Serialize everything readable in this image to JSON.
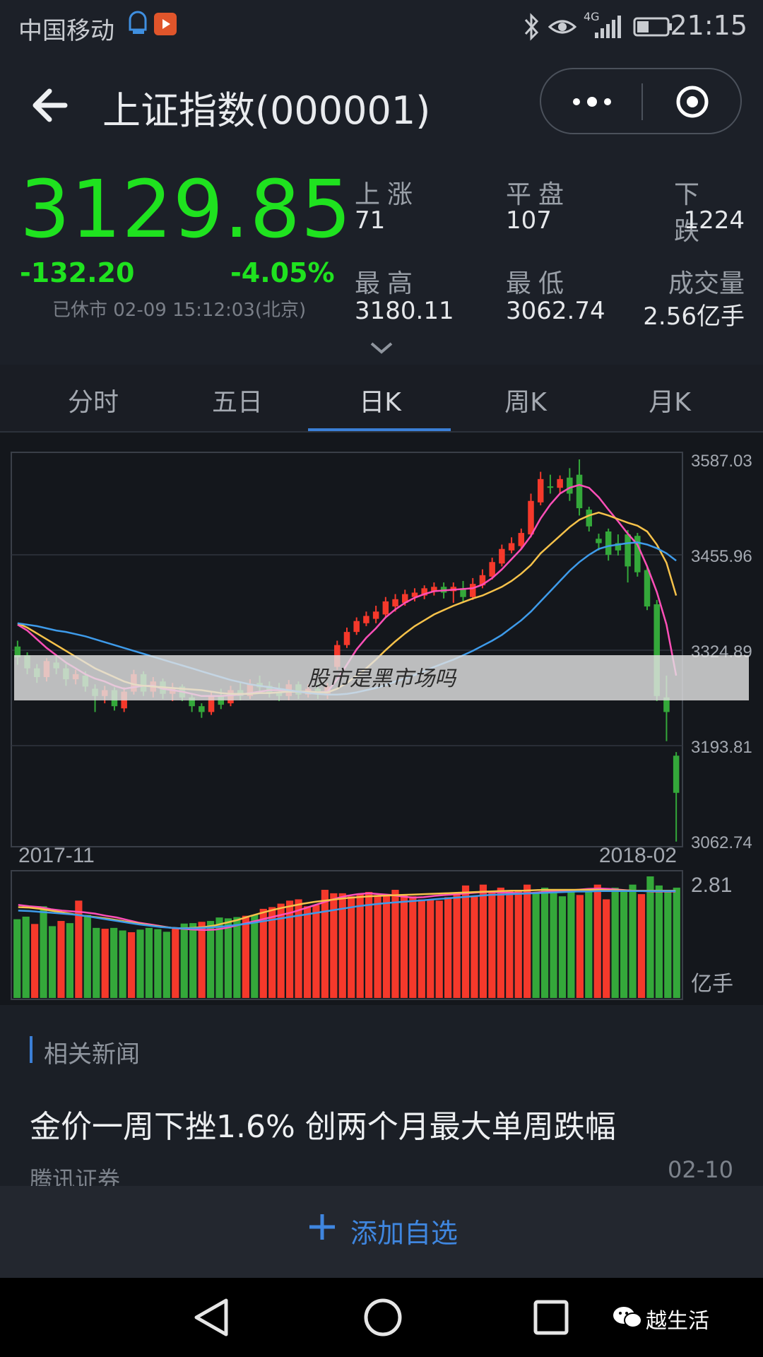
{
  "status_bar": {
    "carrier": "中国移动",
    "network": "4G",
    "time": "21:15"
  },
  "header": {
    "title": "上证指数(000001)"
  },
  "quote": {
    "price": "3129.85",
    "change": "-132.20",
    "change_percent": "-4.05%",
    "market_status": "已休市 02-09 15:12:03(北京)",
    "stats": [
      {
        "label": "上涨",
        "value": "71"
      },
      {
        "label": "平盘",
        "value": "107"
      },
      {
        "label": "下跌",
        "value": "1224"
      },
      {
        "label": "最高",
        "value": "3180.11"
      },
      {
        "label": "最低",
        "value": "3062.74"
      },
      {
        "label": "成交量",
        "value": "2.56亿手"
      }
    ]
  },
  "tabs": [
    {
      "label": "分时",
      "active": false
    },
    {
      "label": "五日",
      "active": false
    },
    {
      "label": "日K",
      "active": true
    },
    {
      "label": "周K",
      "active": false
    },
    {
      "label": "月K",
      "active": false
    }
  ],
  "chart_data": [
    {
      "type": "candlestick",
      "y_ticks": [
        "3587.03",
        "3455.96",
        "3324.89",
        "3193.81",
        "3062.74"
      ],
      "ylim": [
        3062.74,
        3587.03
      ],
      "x_start_label": "2017-11",
      "x_end_label": "2018-02",
      "candles": [
        {
          "o": 3330,
          "c": 3315,
          "h": 3338,
          "l": 3305
        },
        {
          "o": 3318,
          "c": 3300,
          "h": 3322,
          "l": 3292
        },
        {
          "o": 3300,
          "c": 3288,
          "h": 3306,
          "l": 3280
        },
        {
          "o": 3288,
          "c": 3310,
          "h": 3314,
          "l": 3282
        },
        {
          "o": 3308,
          "c": 3300,
          "h": 3318,
          "l": 3292
        },
        {
          "o": 3300,
          "c": 3285,
          "h": 3306,
          "l": 3276
        },
        {
          "o": 3285,
          "c": 3292,
          "h": 3298,
          "l": 3278
        },
        {
          "o": 3290,
          "c": 3275,
          "h": 3296,
          "l": 3268
        },
        {
          "o": 3272,
          "c": 3262,
          "h": 3278,
          "l": 3240
        },
        {
          "o": 3262,
          "c": 3270,
          "h": 3276,
          "l": 3252
        },
        {
          "o": 3270,
          "c": 3248,
          "h": 3274,
          "l": 3242
        },
        {
          "o": 3245,
          "c": 3268,
          "h": 3274,
          "l": 3240
        },
        {
          "o": 3268,
          "c": 3292,
          "h": 3298,
          "l": 3264
        },
        {
          "o": 3292,
          "c": 3268,
          "h": 3296,
          "l": 3262
        },
        {
          "o": 3268,
          "c": 3282,
          "h": 3288,
          "l": 3260
        },
        {
          "o": 3282,
          "c": 3265,
          "h": 3286,
          "l": 3258
        },
        {
          "o": 3265,
          "c": 3273,
          "h": 3280,
          "l": 3255
        },
        {
          "o": 3275,
          "c": 3260,
          "h": 3278,
          "l": 3255
        },
        {
          "o": 3260,
          "c": 3248,
          "h": 3264,
          "l": 3240
        },
        {
          "o": 3248,
          "c": 3240,
          "h": 3252,
          "l": 3232
        },
        {
          "o": 3240,
          "c": 3262,
          "h": 3268,
          "l": 3236
        },
        {
          "o": 3262,
          "c": 3250,
          "h": 3272,
          "l": 3244
        },
        {
          "o": 3252,
          "c": 3270,
          "h": 3276,
          "l": 3248
        },
        {
          "o": 3270,
          "c": 3262,
          "h": 3280,
          "l": 3256
        },
        {
          "o": 3262,
          "c": 3278,
          "h": 3285,
          "l": 3258
        },
        {
          "o": 3280,
          "c": 3274,
          "h": 3290,
          "l": 3268
        },
        {
          "o": 3276,
          "c": 3266,
          "h": 3282,
          "l": 3260
        },
        {
          "o": 3268,
          "c": 3262,
          "h": 3280,
          "l": 3255
        },
        {
          "o": 3262,
          "c": 3278,
          "h": 3284,
          "l": 3256
        },
        {
          "o": 3278,
          "c": 3264,
          "h": 3282,
          "l": 3258
        },
        {
          "o": 3264,
          "c": 3272,
          "h": 3278,
          "l": 3260
        },
        {
          "o": 3272,
          "c": 3264,
          "h": 3280,
          "l": 3258
        },
        {
          "o": 3264,
          "c": 3275,
          "h": 3280,
          "l": 3258
        },
        {
          "o": 3302,
          "c": 3332,
          "h": 3338,
          "l": 3298
        },
        {
          "o": 3332,
          "c": 3350,
          "h": 3356,
          "l": 3328
        },
        {
          "o": 3350,
          "c": 3365,
          "h": 3370,
          "l": 3346
        },
        {
          "o": 3362,
          "c": 3372,
          "h": 3378,
          "l": 3358
        },
        {
          "o": 3368,
          "c": 3378,
          "h": 3386,
          "l": 3362
        },
        {
          "o": 3374,
          "c": 3392,
          "h": 3398,
          "l": 3370
        },
        {
          "o": 3385,
          "c": 3395,
          "h": 3402,
          "l": 3378
        },
        {
          "o": 3390,
          "c": 3402,
          "h": 3408,
          "l": 3386
        },
        {
          "o": 3398,
          "c": 3404,
          "h": 3410,
          "l": 3392
        },
        {
          "o": 3400,
          "c": 3410,
          "h": 3414,
          "l": 3395
        },
        {
          "o": 3406,
          "c": 3412,
          "h": 3418,
          "l": 3400
        },
        {
          "o": 3412,
          "c": 3404,
          "h": 3418,
          "l": 3396
        },
        {
          "o": 3406,
          "c": 3412,
          "h": 3418,
          "l": 3390
        },
        {
          "o": 3410,
          "c": 3398,
          "h": 3420,
          "l": 3392
        },
        {
          "o": 3398,
          "c": 3416,
          "h": 3424,
          "l": 3394
        },
        {
          "o": 3414,
          "c": 3428,
          "h": 3436,
          "l": 3410
        },
        {
          "o": 3426,
          "c": 3446,
          "h": 3452,
          "l": 3422
        },
        {
          "o": 3444,
          "c": 3464,
          "h": 3470,
          "l": 3440
        },
        {
          "o": 3462,
          "c": 3472,
          "h": 3480,
          "l": 3458
        },
        {
          "o": 3468,
          "c": 3486,
          "h": 3492,
          "l": 3464
        },
        {
          "o": 3484,
          "c": 3530,
          "h": 3540,
          "l": 3480
        },
        {
          "o": 3528,
          "c": 3560,
          "h": 3570,
          "l": 3524
        },
        {
          "o": 3550,
          "c": 3548,
          "h": 3566,
          "l": 3540
        },
        {
          "o": 3548,
          "c": 3560,
          "h": 3565,
          "l": 3540
        },
        {
          "o": 3562,
          "c": 3540,
          "h": 3575,
          "l": 3530
        },
        {
          "o": 3566,
          "c": 3520,
          "h": 3587,
          "l": 3510
        },
        {
          "o": 3518,
          "c": 3495,
          "h": 3522,
          "l": 3488
        },
        {
          "o": 3478,
          "c": 3472,
          "h": 3485,
          "l": 3462
        },
        {
          "o": 3488,
          "c": 3456,
          "h": 3492,
          "l": 3448
        },
        {
          "o": 3472,
          "c": 3462,
          "h": 3484,
          "l": 3455
        },
        {
          "o": 3484,
          "c": 3440,
          "h": 3490,
          "l": 3418
        },
        {
          "o": 3482,
          "c": 3432,
          "h": 3486,
          "l": 3426
        },
        {
          "o": 3435,
          "c": 3385,
          "h": 3440,
          "l": 3380
        },
        {
          "o": 3388,
          "c": 3262,
          "h": 3394,
          "l": 3255
        },
        {
          "o": 3260,
          "c": 3240,
          "h": 3290,
          "l": 3200
        },
        {
          "o": 3180,
          "c": 3129,
          "h": 3185,
          "l": 3062
        }
      ],
      "ma_lines": [
        {
          "color": "#ff4fb8",
          "values": [
            3360,
            3352,
            3340,
            3328,
            3318,
            3308,
            3300,
            3292,
            3286,
            3282,
            3276,
            3272,
            3274,
            3276,
            3276,
            3272,
            3270,
            3268,
            3265,
            3262,
            3262,
            3262,
            3263,
            3264,
            3266,
            3268,
            3270,
            3270,
            3268,
            3268,
            3268,
            3267,
            3268,
            3285,
            3305,
            3326,
            3342,
            3355,
            3370,
            3381,
            3390,
            3397,
            3402,
            3406,
            3407,
            3408,
            3409,
            3410,
            3415,
            3424,
            3436,
            3450,
            3464,
            3482,
            3506,
            3525,
            3540,
            3548,
            3552,
            3548,
            3535,
            3518,
            3502,
            3485,
            3470,
            3440,
            3405,
            3360,
            3290
          ]
        },
        {
          "color": "#f6c24a",
          "values": [
            3362,
            3356,
            3348,
            3340,
            3332,
            3324,
            3316,
            3308,
            3300,
            3294,
            3288,
            3282,
            3278,
            3276,
            3275,
            3274,
            3273,
            3272,
            3271,
            3270,
            3268,
            3266,
            3265,
            3265,
            3265,
            3266,
            3266,
            3267,
            3268,
            3268,
            3268,
            3267,
            3267,
            3272,
            3280,
            3290,
            3300,
            3312,
            3325,
            3337,
            3348,
            3358,
            3366,
            3374,
            3380,
            3386,
            3391,
            3396,
            3400,
            3406,
            3412,
            3420,
            3430,
            3442,
            3458,
            3470,
            3482,
            3494,
            3504,
            3510,
            3514,
            3510,
            3505,
            3500,
            3496,
            3488,
            3470,
            3445,
            3400
          ]
        },
        {
          "color": "#3e9bea",
          "values": [
            3362,
            3360,
            3358,
            3355,
            3352,
            3350,
            3347,
            3344,
            3340,
            3336,
            3332,
            3328,
            3324,
            3320,
            3316,
            3312,
            3308,
            3304,
            3300,
            3296,
            3292,
            3288,
            3284,
            3281,
            3278,
            3276,
            3274,
            3272,
            3270,
            3268,
            3266,
            3265,
            3264,
            3264,
            3265,
            3267,
            3270,
            3273,
            3277,
            3282,
            3286,
            3291,
            3296,
            3302,
            3307,
            3312,
            3318,
            3324,
            3331,
            3338,
            3346,
            3356,
            3366,
            3378,
            3392,
            3406,
            3420,
            3434,
            3446,
            3456,
            3464,
            3468,
            3470,
            3472,
            3473,
            3470,
            3465,
            3458,
            3448
          ]
        }
      ]
    },
    {
      "type": "bar",
      "unit_label": "亿手",
      "max_label": "2.81",
      "ylim": [
        0,
        2.81
      ],
      "values": [
        1.82,
        1.88,
        1.71,
        2.12,
        1.66,
        1.78,
        1.73,
        2.25,
        1.92,
        1.62,
        1.6,
        1.62,
        1.56,
        1.52,
        1.58,
        1.62,
        1.59,
        1.53,
        1.6,
        1.72,
        1.73,
        1.76,
        1.78,
        1.86,
        1.84,
        1.87,
        1.9,
        1.92,
        2.06,
        2.1,
        2.18,
        2.25,
        2.28,
        2.12,
        2.15,
        2.5,
        2.42,
        2.42,
        2.35,
        2.4,
        2.45,
        2.38,
        2.4,
        2.5,
        2.38,
        2.35,
        2.28,
        2.28,
        2.25,
        2.33,
        2.4,
        2.6,
        2.35,
        2.62,
        2.45,
        2.55,
        2.48,
        2.5,
        2.62,
        2.42,
        2.55,
        2.48,
        2.35,
        2.45,
        2.38,
        2.45,
        2.62,
        2.28,
        2.55,
        2.48,
        2.62,
        2.4,
        2.81,
        2.6,
        2.45,
        2.55
      ],
      "up": [
        false,
        false,
        true,
        false,
        false,
        true,
        false,
        true,
        false,
        false,
        true,
        false,
        false,
        true,
        false,
        false,
        false,
        false,
        true,
        false,
        false,
        true,
        false,
        false,
        false,
        false,
        true,
        false,
        true,
        true,
        true,
        true,
        true,
        true,
        true,
        true,
        true,
        true,
        true,
        true,
        true,
        true,
        true,
        true,
        true,
        true,
        true,
        true,
        true,
        true,
        true,
        true,
        true,
        true,
        true,
        true,
        true,
        true,
        true,
        false,
        false,
        false,
        false,
        false,
        true,
        false,
        true,
        true,
        false,
        false,
        false,
        true,
        false,
        false,
        false,
        false
      ],
      "ma_lines": [
        {
          "color": "#ff4fb8",
          "values": [
            2.15,
            2.12,
            2.1,
            2.05,
            2.02,
            2.0,
            1.98,
            1.95,
            1.9,
            1.86,
            1.8,
            1.74,
            1.7,
            1.66,
            1.62,
            1.6,
            1.58,
            1.57,
            1.58,
            1.62,
            1.68,
            1.74,
            1.8,
            1.86,
            1.92,
            1.98,
            2.06,
            2.14,
            2.22,
            2.3,
            2.36,
            2.4,
            2.42,
            2.4,
            2.38,
            2.35,
            2.32,
            2.33,
            2.36,
            2.38,
            2.4,
            2.42,
            2.44,
            2.45,
            2.44,
            2.43,
            2.42,
            2.43,
            2.45,
            2.47,
            2.48,
            2.5,
            2.52,
            2.53,
            2.52,
            2.5,
            2.48,
            2.47,
            2.46,
            2.46,
            2.46
          ]
        },
        {
          "color": "#f6c24a",
          "values": [
            2.1,
            2.09,
            2.06,
            2.02,
            1.98,
            1.94,
            1.9,
            1.87,
            1.84,
            1.8,
            1.76,
            1.72,
            1.68,
            1.65,
            1.62,
            1.61,
            1.62,
            1.64,
            1.68,
            1.74,
            1.8,
            1.88,
            1.95,
            2.02,
            2.08,
            2.13,
            2.18,
            2.22,
            2.25,
            2.28,
            2.31,
            2.33,
            2.35,
            2.36,
            2.37,
            2.38,
            2.39,
            2.4,
            2.41,
            2.42,
            2.43,
            2.44,
            2.45,
            2.46,
            2.47,
            2.48,
            2.48,
            2.49,
            2.5,
            2.5,
            2.5,
            2.5,
            2.5,
            2.5,
            2.49,
            2.49,
            2.48,
            2.48,
            2.48,
            2.48,
            2.48
          ]
        },
        {
          "color": "#3e9bea",
          "values": [
            2.02,
            2.01,
            1.99,
            1.97,
            1.95,
            1.93,
            1.9,
            1.86,
            1.82,
            1.78,
            1.74,
            1.7,
            1.67,
            1.64,
            1.62,
            1.61,
            1.61,
            1.62,
            1.64,
            1.66,
            1.69,
            1.72,
            1.76,
            1.8,
            1.84,
            1.88,
            1.92,
            1.96,
            2.0,
            2.04,
            2.08,
            2.12,
            2.15,
            2.18,
            2.2,
            2.22,
            2.24,
            2.26,
            2.28,
            2.3,
            2.32,
            2.34,
            2.36,
            2.38,
            2.39,
            2.4,
            2.41,
            2.42,
            2.43,
            2.44,
            2.45,
            2.46,
            2.46,
            2.47,
            2.47,
            2.47,
            2.47,
            2.47,
            2.47,
            2.47,
            2.47
          ]
        }
      ]
    }
  ],
  "overlay_caption": "股市是黑市场吗",
  "news": {
    "heading": "相关新闻",
    "title": "金价一周下挫1.6% 创两个月最大单周跌幅",
    "source": "腾讯证券",
    "date": "02-10"
  },
  "add_watchlist": "添加自选",
  "watermark": "越生活",
  "colors": {
    "up": "#f5392b",
    "down": "#34a83a",
    "price_green": "#1fe21f",
    "accent": "#3b7fd6"
  }
}
